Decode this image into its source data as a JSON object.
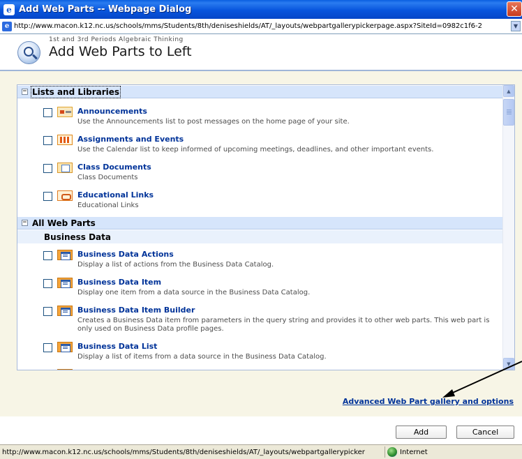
{
  "window": {
    "title": "Add Web Parts -- Webpage Dialog",
    "close_glyph": "✕",
    "app_icon_glyph": "e"
  },
  "address": {
    "url": "http://www.macon.k12.nc.us/schools/mms/Students/8th/deniseshields/AT/_layouts/webpartgallerypickerpage.aspx?SiteId=0982c1f6-2",
    "dropdown_glyph": "▼"
  },
  "header": {
    "subtitle": "1st and 3rd Periods Algebraic Thinking",
    "title": "Add Web Parts to Left"
  },
  "groups": [
    {
      "label": "Lists and Libraries",
      "toggle": "−",
      "items": [
        {
          "title": "Announcements",
          "desc": "Use the Announcements list to post messages on the home page of your site.",
          "icon": "announcements-icon"
        },
        {
          "title": "Assignments and Events",
          "desc": "Use the Calendar list to keep informed of upcoming meetings, deadlines, and other important events.",
          "icon": "calendar-icon"
        },
        {
          "title": "Class Documents",
          "desc": "Class Documents",
          "icon": "document-library-icon"
        },
        {
          "title": "Educational Links",
          "desc": "Educational Links",
          "icon": "links-icon"
        }
      ]
    },
    {
      "label": "All Web Parts",
      "toggle": "−",
      "category": "Business Data",
      "items": [
        {
          "title": "Business Data Actions",
          "desc": "Display a list of actions from the Business Data Catalog.",
          "icon": "business-data-icon"
        },
        {
          "title": "Business Data Item",
          "desc": "Display one item from a data source in the Business Data Catalog.",
          "icon": "business-data-icon"
        },
        {
          "title": "Business Data Item Builder",
          "desc": "Creates a Business Data item from parameters in the query string and provides it to other web parts. This web part is only used on Business Data profile pages.",
          "icon": "business-data-icon"
        },
        {
          "title": "Business Data List",
          "desc": "Display a list of items from a data source in the Business Data Catalog.",
          "icon": "business-data-icon"
        }
      ]
    }
  ],
  "scroll": {
    "up": "▲",
    "down": "▼"
  },
  "advanced_link": "Advanced Web Part gallery and options",
  "buttons": {
    "add": "Add",
    "cancel": "Cancel"
  },
  "status": {
    "url": "http://www.macon.k12.nc.us/schools/mms/Students/8th/deniseshields/AT/_layouts/webpartgallerypicker",
    "zone": "Internet"
  }
}
